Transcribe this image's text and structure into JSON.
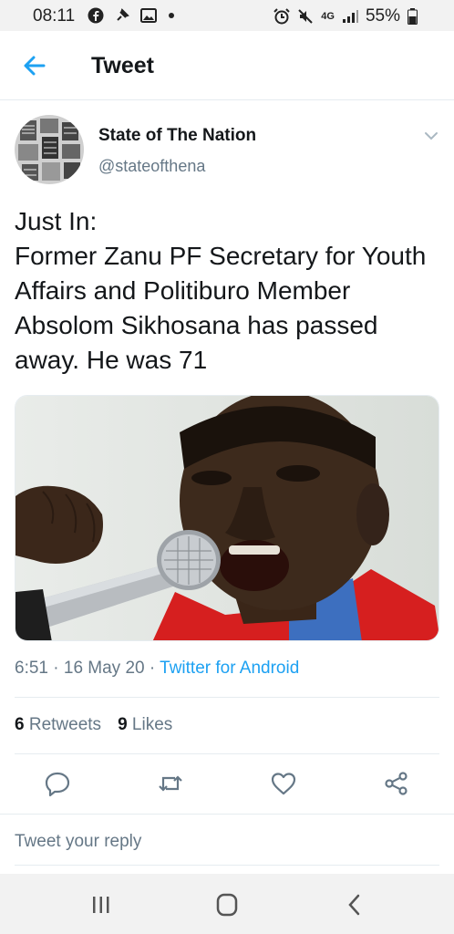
{
  "status_bar": {
    "time": "08:11",
    "network": "4G",
    "battery": "55%",
    "icons_left": [
      "facebook-icon",
      "pin-icon",
      "image-icon",
      "dot-icon"
    ],
    "icons_right": [
      "alarm-icon",
      "mute-icon",
      "signal-icon",
      "battery-icon"
    ]
  },
  "header": {
    "back_icon": "arrow-left-icon",
    "title": "Tweet"
  },
  "author": {
    "name": "State of The Nation",
    "handle": "@stateofthena"
  },
  "tweet": {
    "text": "Just In:\nFormer Zanu PF Secretary for Youth Affairs and Politiburo Member Absolom Sikhosana has passed away. He was 71",
    "time": "6:51",
    "date": "16 May 20",
    "separator": "·",
    "source": "Twitter for Android"
  },
  "stats": {
    "retweets_count": "6",
    "retweets_label": "Retweets",
    "likes_count": "9",
    "likes_label": "Likes"
  },
  "actions": [
    "reply-icon",
    "retweet-icon",
    "like-icon",
    "share-icon"
  ],
  "reply": {
    "placeholder": "Tweet your reply"
  },
  "nav": [
    "recent-apps-icon",
    "home-icon",
    "back-icon"
  ],
  "colors": {
    "accent": "#1da1f2",
    "secondary_text": "#657786",
    "primary_text": "#14171a",
    "divider": "#e6ecf0"
  }
}
